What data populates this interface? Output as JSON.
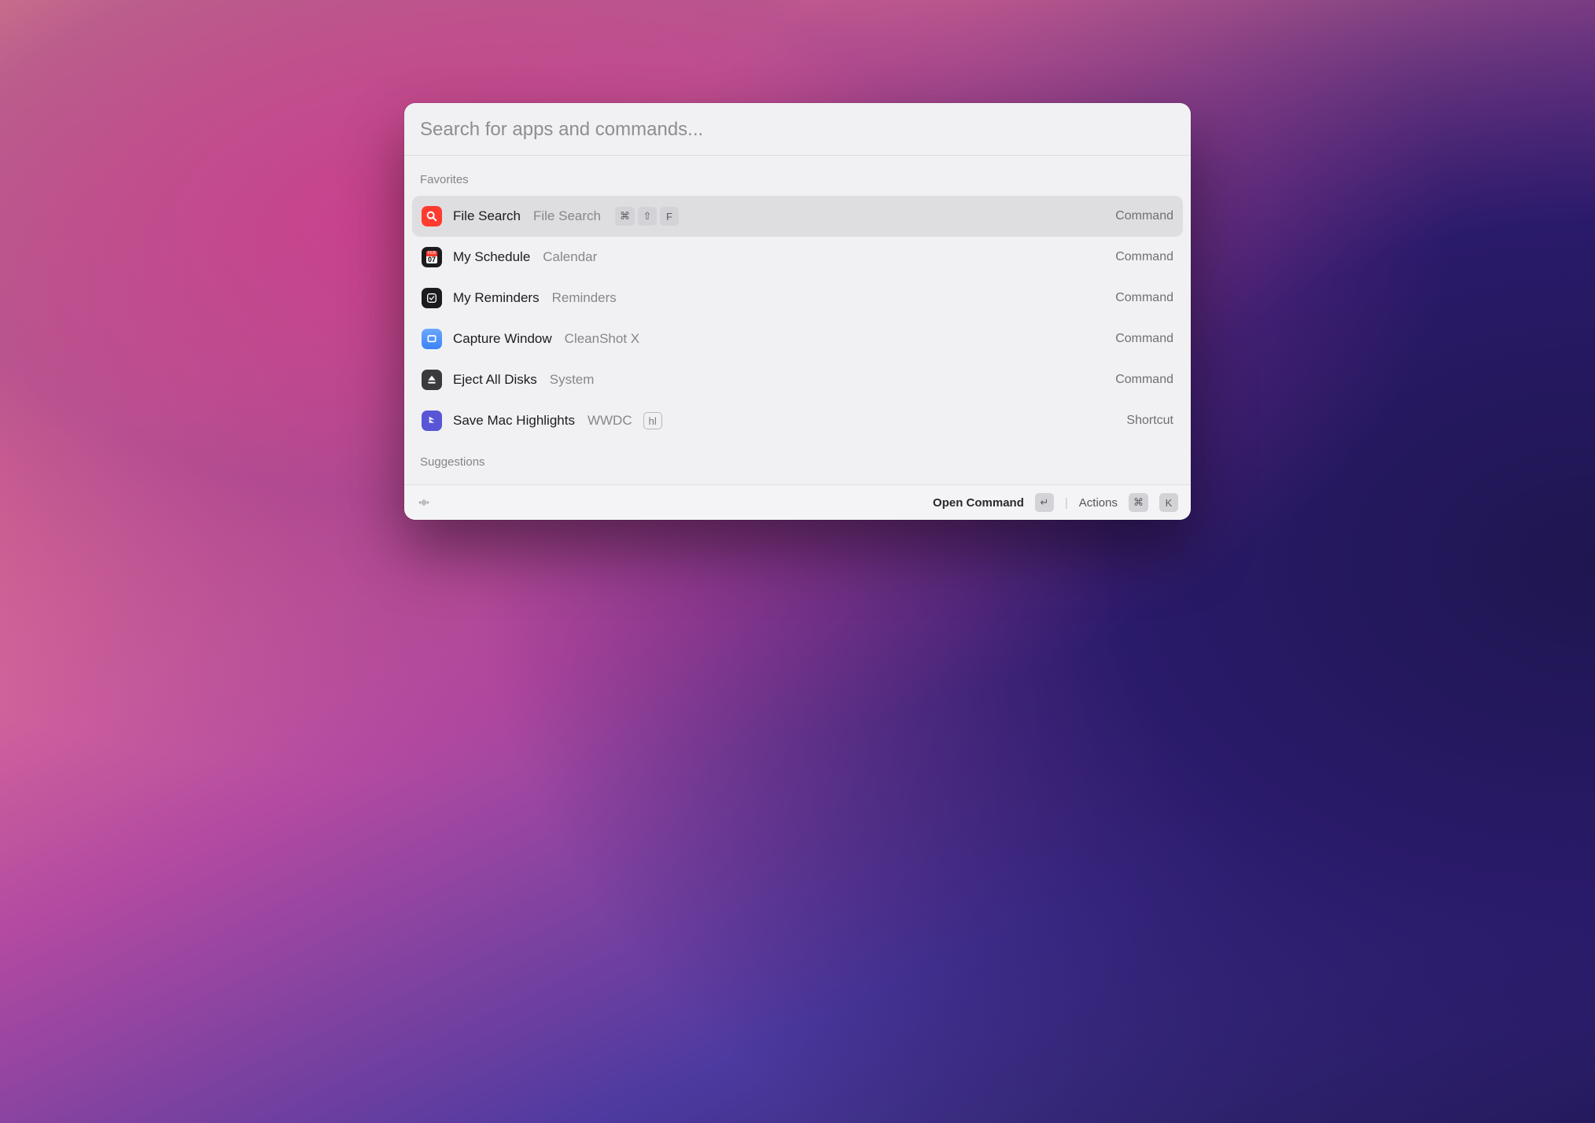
{
  "search": {
    "placeholder": "Search for apps and commands..."
  },
  "sections": {
    "favorites_label": "Favorites",
    "suggestions_label": "Suggestions"
  },
  "favorites": [
    {
      "title": "File Search",
      "subtitle": "File Search",
      "type": "Command",
      "keys": [
        "⌘",
        "⇧",
        "F"
      ]
    },
    {
      "title": "My Schedule",
      "subtitle": "Calendar",
      "type": "Command"
    },
    {
      "title": "My Reminders",
      "subtitle": "Reminders",
      "type": "Command"
    },
    {
      "title": "Capture Window",
      "subtitle": "CleanShot X",
      "type": "Command"
    },
    {
      "title": "Eject All Disks",
      "subtitle": "System",
      "type": "Command"
    },
    {
      "title": "Save Mac Highlights",
      "subtitle": "WWDC",
      "type": "Shortcut",
      "badge": "hl"
    }
  ],
  "footer": {
    "primary_action": "Open Command",
    "primary_key": "↵",
    "actions_label": "Actions",
    "actions_keys": [
      "⌘",
      "K"
    ]
  },
  "calendar_icon": {
    "month": "FEB",
    "day": "07"
  }
}
